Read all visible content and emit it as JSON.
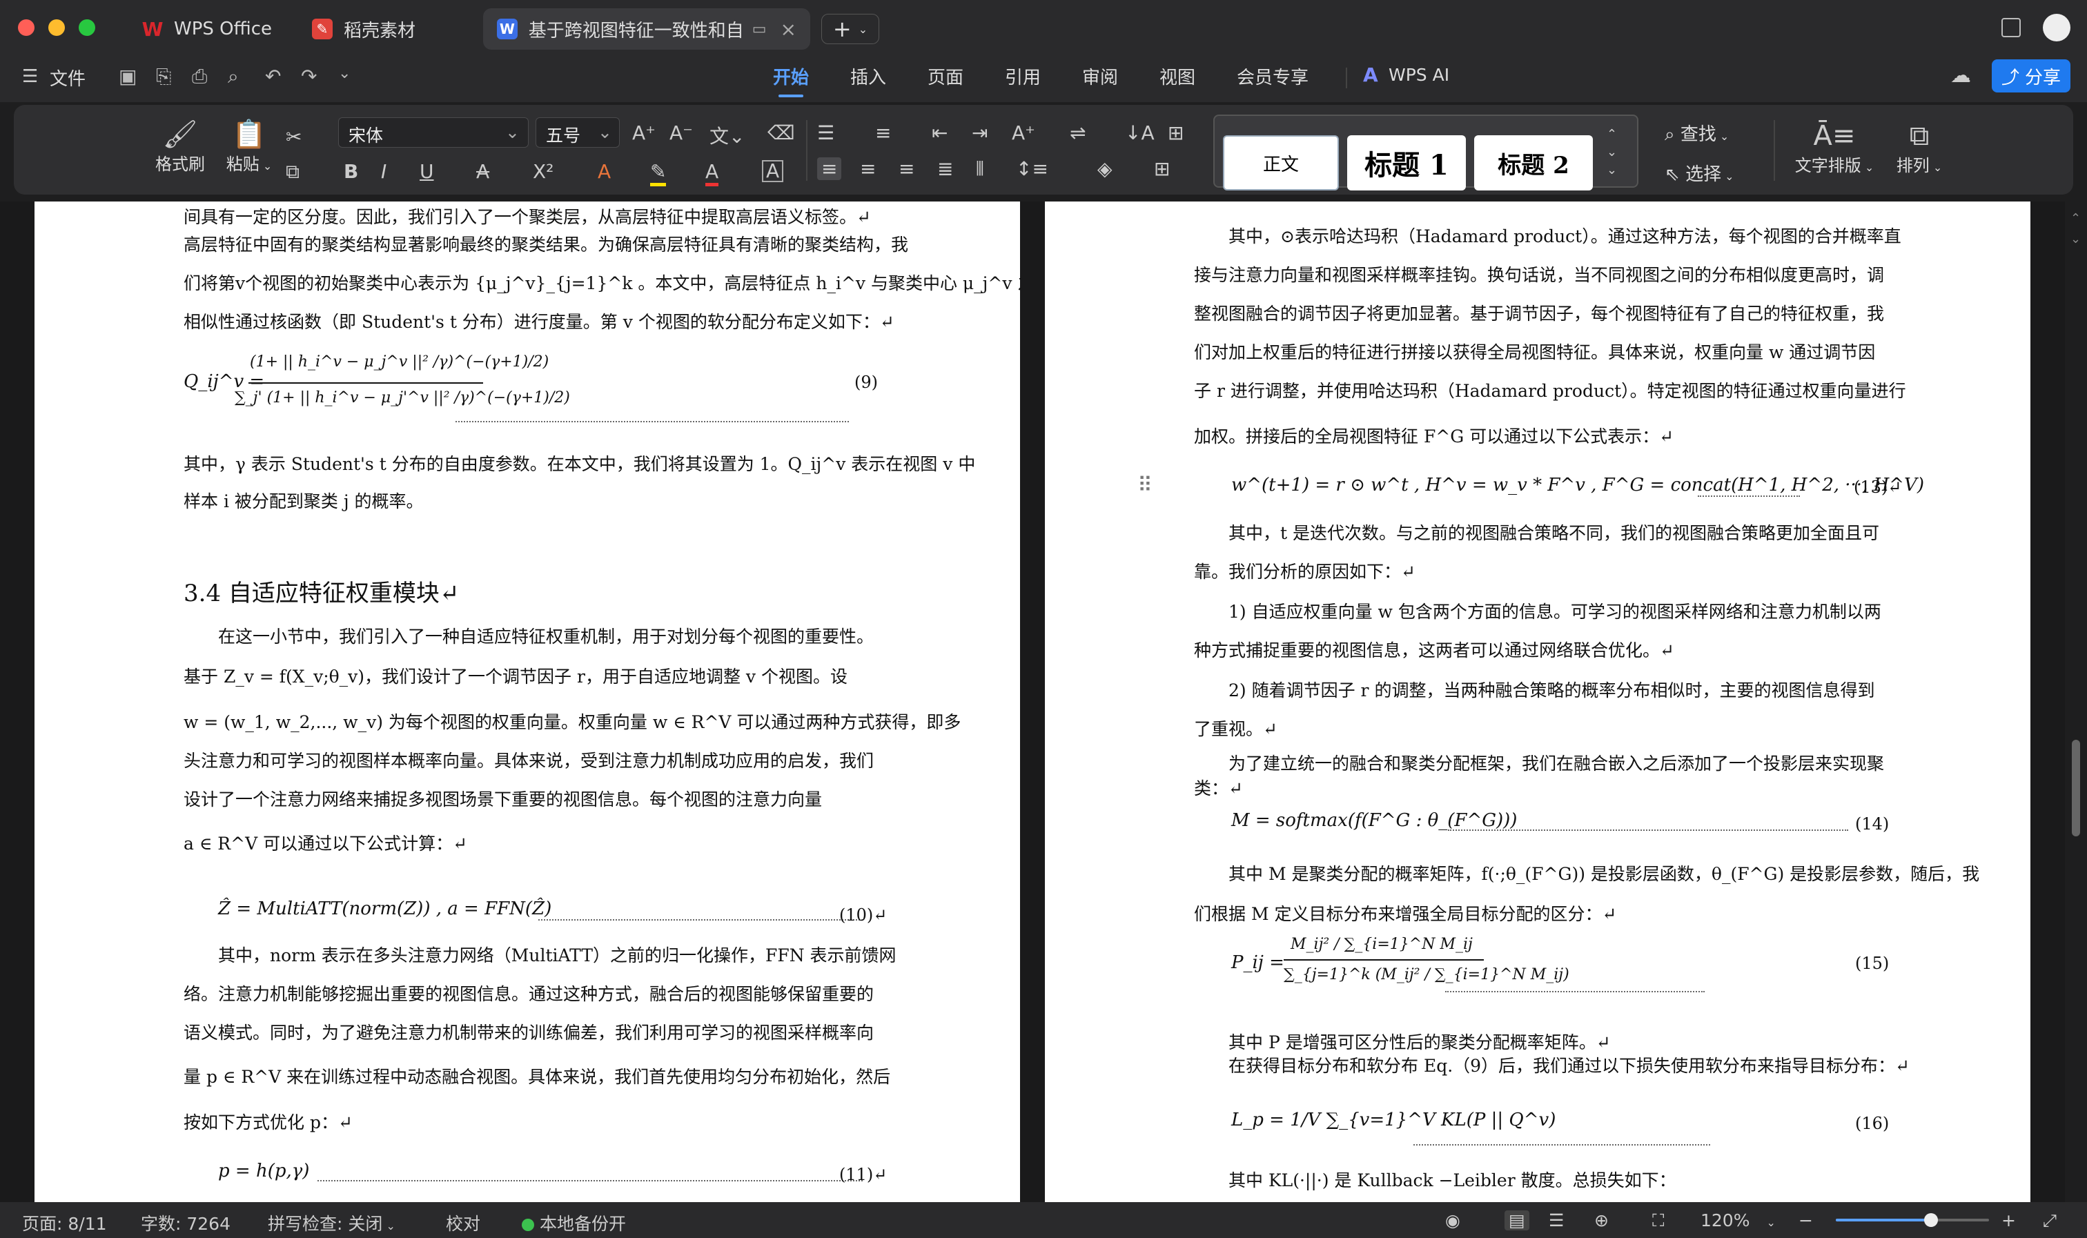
{
  "titlebar": {
    "tabs": [
      {
        "label": "WPS Office",
        "icon": "wps-logo-icon",
        "color": "#d9262c"
      },
      {
        "label": "稻壳素材",
        "icon": "docer-icon",
        "color": "#e0433b"
      },
      {
        "label": "基于跨视图特征一致性和自",
        "icon": "word-doc-icon",
        "color": "#3b6fe6"
      }
    ],
    "new_tab": "+"
  },
  "menubar": {
    "file_label": "文件",
    "tabs": [
      "开始",
      "插入",
      "页面",
      "引用",
      "审阅",
      "视图",
      "会员专享"
    ],
    "active_tab": "开始",
    "ai_label": "WPS AI",
    "share_label": "分享"
  },
  "ribbon": {
    "format_painter": "格式刷",
    "paste": "粘贴",
    "font_name": "宋体",
    "font_size": "五号",
    "styles": [
      "正文",
      "标题 1",
      "标题 2"
    ],
    "find": "查找",
    "select": "选择",
    "text_layout": "文字排版",
    "arrange": "排列"
  },
  "doc": {
    "left": {
      "lines": [
        "间具有一定的区分度。因此，我们引入了一个聚类层，从高层特征中提取高层语义标签。↵",
        "高层特征中固有的聚类结构显著影响最终的聚类结果。为确保高层特征具有清晰的聚类结构，我",
        "们将第v个视图的初始聚类中心表示为 {μ_j^v}_{j=1}^k 。本文中，高层特征点 h_i^v 与聚类中心 μ_j^v 之间的",
        "相似性通过核函数（即 Student's t 分布）进行度量。第 v 个视图的软分配分布定义如下：↵"
      ],
      "eq9_num": "(9)",
      "eq9_numer": "(1+ || h_i^v − μ_j^v ||² /γ)^(−(γ+1)/2)",
      "eq9_denom": "∑_j' (1+ || h_i^v − μ_j'^v ||² /γ)^(−(γ+1)/2)",
      "eq9_lhs": "Q_ij^v =",
      "after9": [
        "其中，γ 表示 Student's t 分布的自由度参数。在本文中，我们将其设置为 1。Q_ij^v 表示在视图 v 中",
        "样本 i 被分配到聚类 j 的概率。"
      ],
      "heading": "3.4 自适应特征权重模块↵",
      "sec_lines": [
        "在这一小节中，我们引入了一种自适应特征权重机制，用于对划分每个视图的重要性。",
        "基于 Z_v = f(X_v;θ_v)，我们设计了一个调节因子 r，用于自适应地调整 v 个视图。设",
        "w = (w_1, w_2,..., w_v) 为每个视图的权重向量。权重向量 w ∈ R^V 可以通过两种方式获得，即多",
        "头注意力和可学习的视图样本概率向量。具体来说，受到注意力机制成功应用的启发，我们",
        "设计了一个注意力网络来捕捉多视图场景下重要的视图信息。每个视图的注意力向量",
        "a ∈ R^V 可以通过以下公式计算：↵"
      ],
      "eq10": "Ẑ = MultiATT(norm(Z)) ,  a = FFN(Ẑ)",
      "eq10_num": "(10)↵",
      "after10": [
        "其中，norm 表示在多头注意力网络（MultiATT）之前的归一化操作，FFN 表示前馈网",
        "络。注意力机制能够挖掘出重要的视图信息。通过这种方式，融合后的视图能够保留重要的",
        "语义模式。同时，为了避免注意力机制带来的训练偏差，我们利用可学习的视图采样概率向",
        "量 p ∈ R^V 来在训练过程中动态融合视图。具体来说，我们首先使用均匀分布初始化，然后",
        "按如下方式优化 p：↵"
      ],
      "eq11": "p = h(p,γ)",
      "eq11_num": "(11)↵"
    },
    "right": {
      "lines": [
        "其中，⊙表示哈达玛积（Hadamard product）。通过这种方法，每个视图的合并概率直",
        "接与注意力向量和视图采样概率挂钩。换句话说，当不同视图之间的分布相似度更高时，调",
        "整视图融合的调节因子将更加显著。基于调节因子，每个视图特征有了自己的特征权重，我",
        "们对加上权重后的特征进行拼接以获得全局视图特征。具体来说，权重向量 w 通过调节因",
        "子 r 进行调整，并使用哈达玛积（Hadamard product）。特定视图的特征通过权重向量进行",
        "加权。拼接后的全局视图特征 F^G 可以通过以下公式表示：↵"
      ],
      "eq13": "w^(t+1) = r ⊙ w^t ,  H^v = w_v * F^v , F^G = concat(H^1, H^2, ···, H^V)",
      "eq13_num": "(13)↵",
      "after13": [
        "其中，t 是迭代次数。与之前的视图融合策略不同，我们的视图融合策略更加全面且可",
        "靠。我们分析的原因如下：↵",
        "1) 自适应权重向量 w 包含两个方面的信息。可学习的视图采样网络和注意力机制以两",
        "种方式捕捉重要的视图信息，这两者可以通过网络联合优化。↵",
        "2) 随着调节因子 r 的调整，当两种融合策略的概率分布相似时，主要的视图信息得到",
        "了重视。↵",
        "为了建立统一的融合和聚类分配框架，我们在融合嵌入之后添加了一个投影层来实现聚",
        "类：↵"
      ],
      "eq14": "M = softmax(f(F^G : θ_(F^G)))",
      "eq14_num": "(14)",
      "after14": [
        "其中 M 是聚类分配的概率矩阵，f(·;θ_(F^G)) 是投影层函数，θ_(F^G) 是投影层参数，随后，我",
        "们根据 M 定义目标分布来增强全局目标分配的区分：↵"
      ],
      "eq15_lhs": "P_ij =",
      "eq15_numer": "M_ij² / ∑_{i=1}^N M_ij",
      "eq15_denom": "∑_{j=1}^k (M_ij² / ∑_{i=1}^N M_ij)",
      "eq15_num": "(15)",
      "after15": [
        "其中 P 是增强可区分性后的聚类分配概率矩阵。↵",
        "在获得目标分布和软分布 Eq.（9）后，我们通过以下损失使用软分布来指导目标分布：↵"
      ],
      "eq16": "L_p = 1/V ∑_{v=1}^V KL(P || Q^v)",
      "eq16_num": "(16)",
      "last_line": "其中 KL(·||·) 是 Kullback −Leibler 散度。总损失如下："
    }
  },
  "statusbar": {
    "page": "页面: 8/11",
    "words": "字数: 7264",
    "spell": "拼写检查: 关闭",
    "proof": "校对",
    "backup": "本地备份开",
    "zoom": "120%",
    "zoom_fraction": 0.62
  },
  "colors": {
    "accent": "#5aa0ff",
    "share_button": "#1f7aef",
    "backup_dot": "#3cc24f"
  }
}
